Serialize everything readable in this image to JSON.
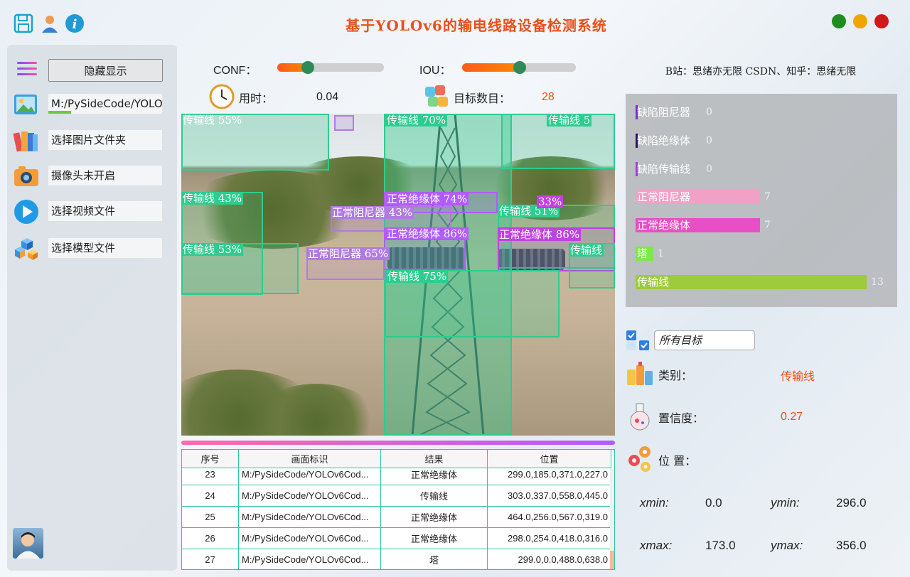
{
  "titlebar": {
    "title": "基于YOLOv6的输电线路设备检测系统",
    "icons": [
      "save-icon",
      "user-icon",
      "info-icon"
    ],
    "window_buttons": {
      "green": "#1e8c1e",
      "yellow": "#f0a500",
      "red": "#d01818"
    }
  },
  "sidebar": {
    "hide_label": "隐藏显示",
    "path_value": "M:/PySideCode/YOLO",
    "path_progress": 0.2,
    "items": [
      {
        "label": "选择图片文件夹",
        "icon": "books-icon"
      },
      {
        "label": "摄像头未开启",
        "icon": "camera-icon"
      },
      {
        "label": "选择视频文件",
        "icon": "play-icon"
      },
      {
        "label": "选择模型文件",
        "icon": "cubes-icon"
      }
    ]
  },
  "controls": {
    "conf_label": "CONF：",
    "conf_value": 0.25,
    "iou_label": "IOU：",
    "iou_value": 0.5,
    "time_label": "用时：",
    "time_value": "0.04",
    "count_label": "目标数目：",
    "count_value": "28"
  },
  "detections": [
    {
      "label": "传输线 55%",
      "color": "#2ecc8f"
    },
    {
      "label": "传输线 70%",
      "color": "#2ecc8f"
    },
    {
      "label": "传输线 5",
      "color": "#2ecc8f"
    },
    {
      "label": "传输线 43%",
      "color": "#2ecc8f"
    },
    {
      "label": "正常绝缘体 74%",
      "color": "#b05cff"
    },
    {
      "label": "正常阻尼器 43%",
      "color": "#b07be0"
    },
    {
      "label": "传输线 51%",
      "color": "#2ecc8f"
    },
    {
      "label": "33%",
      "color": "#c040e0"
    },
    {
      "label": "正常绝缘体 86%",
      "color": "#b05cff"
    },
    {
      "label": "正常绝缘体 86%",
      "color": "#c040e0"
    },
    {
      "label": "传输线 53%",
      "color": "#2ecc8f"
    },
    {
      "label": "正常阻尼器 65%",
      "color": "#b07be0"
    },
    {
      "label": "传输线 75%",
      "color": "#2ecc8f"
    },
    {
      "label": "传输线",
      "color": "#2ecc8f"
    }
  ],
  "table": {
    "headers": [
      "序号",
      "画面标识",
      "结果",
      "位置"
    ],
    "rows": [
      [
        "23",
        "M:/PySideCode/YOLOv6Cod...",
        "正常绝缘体",
        "299.0,185.0,371.0,227.0"
      ],
      [
        "24",
        "M:/PySideCode/YOLOv6Cod...",
        "传输线",
        "303.0,337.0,558.0,445.0"
      ],
      [
        "25",
        "M:/PySideCode/YOLOv6Cod...",
        "正常绝缘体",
        "464.0,256.0,567.0,319.0"
      ],
      [
        "26",
        "M:/PySideCode/YOLOv6Cod...",
        "正常绝缘体",
        "298.0,254.0,418.0,316.0"
      ],
      [
        "27",
        "M:/PySideCode/YOLOv6Cod...",
        "塔",
        "299.0,0.0,488.0,638.0"
      ]
    ]
  },
  "right": {
    "credit": "B站：思绪亦无限  CSDN、知乎：思绪无限",
    "stats": [
      {
        "label": "缺陷阻尼器",
        "count": "0",
        "value": 0,
        "color": "#7a2bd1"
      },
      {
        "label": "缺陷绝缘体",
        "count": "0",
        "value": 0,
        "color": "#2a1360"
      },
      {
        "label": "缺陷传输线",
        "count": "0",
        "value": 0,
        "color": "#9b3ce0"
      },
      {
        "label": "正常阻尼器",
        "count": "7",
        "value": 7,
        "color": "#f2a0c6"
      },
      {
        "label": "正常绝缘体",
        "count": "7",
        "value": 7,
        "color": "#e84fc4"
      },
      {
        "label": "塔",
        "count": "1",
        "value": 1,
        "color": "#7de84a"
      },
      {
        "label": "传输线",
        "count": "13",
        "value": 13,
        "color": "#9ccc3a"
      }
    ],
    "select_value": "所有目标",
    "class_label": "类别：",
    "class_value": "传输线",
    "conf_label": "置信度：",
    "conf_value": "0.27",
    "pos_label": "位 置：",
    "xmin_label": "xmin:",
    "xmin": "0.0",
    "ymin_label": "ymin:",
    "ymin": "296.0",
    "xmax_label": "xmax:",
    "xmax": "173.0",
    "ymax_label": "ymax:",
    "ymax": "356.0"
  }
}
